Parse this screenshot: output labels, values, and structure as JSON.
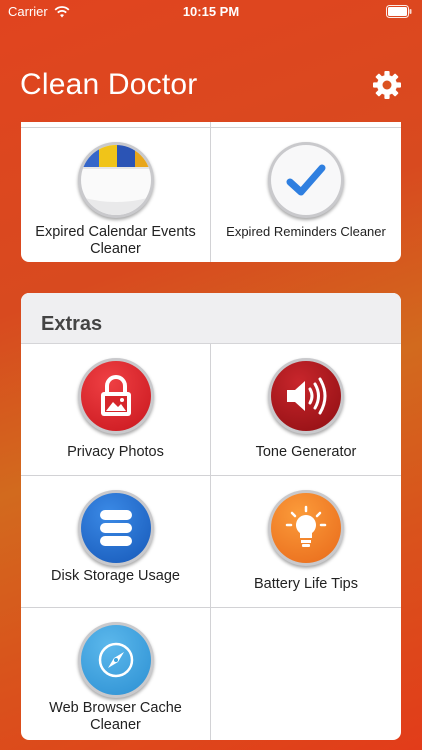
{
  "status": {
    "carrier": "Carrier",
    "time": "10:15 PM"
  },
  "app": {
    "title": "Clean Doctor"
  },
  "top_items": [
    {
      "label": "Expired Calendar Events Cleaner",
      "icon": "calendar-icon"
    },
    {
      "label": "Expired Reminders Cleaner",
      "icon": "checkmark-icon"
    }
  ],
  "extras": {
    "header": "Extras",
    "items": [
      {
        "label": "Privacy Photos",
        "icon": "lock-photo-icon",
        "color": "#d6262b"
      },
      {
        "label": "Tone Generator",
        "icon": "speaker-icon",
        "color": "#b3161b"
      },
      {
        "label": "Disk Storage Usage",
        "icon": "database-icon",
        "color": "#1f6fd1"
      },
      {
        "label": "Battery Life Tips",
        "icon": "lightbulb-icon",
        "color": "#f07b1e"
      },
      {
        "label": "Web Browser Cache Cleaner",
        "icon": "compass-icon",
        "color": "#3aa2de"
      }
    ]
  }
}
